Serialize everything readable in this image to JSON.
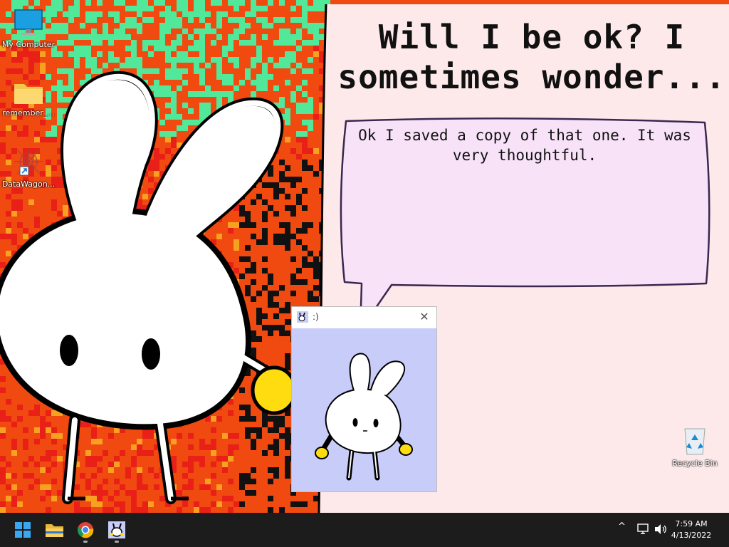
{
  "desktop_icons": [
    {
      "label": "My Computer",
      "icon": "monitor-icon"
    },
    {
      "label": "remember_...",
      "icon": "folder-icon"
    },
    {
      "label": "DataWagon...",
      "icon": "datawagon-shortcut-icon"
    },
    {
      "label": "Recycle Bin",
      "icon": "recycle-bin-icon"
    }
  ],
  "speech": {
    "title_line1": "Will I be ok? I",
    "title_line2": "sometimes wonder...",
    "message_line1": "Ok I saved a copy of that one. It was",
    "message_line2": "very thoughtful."
  },
  "window": {
    "title": ":)",
    "close_glyph": "✕",
    "content_bg": "#c8ccf8"
  },
  "taskbar": {
    "apps": [
      {
        "name": "start",
        "icon": "windows-start-icon"
      },
      {
        "name": "file-explorer",
        "icon": "folder-icon"
      },
      {
        "name": "chrome",
        "icon": "chrome-icon"
      },
      {
        "name": "bunny-app",
        "icon": "bunny-icon"
      }
    ],
    "tray": {
      "chevron": "^",
      "time": "7:59 AM",
      "date": "4/13/2022"
    }
  },
  "colors": {
    "background_orange": "#f04a10",
    "pixel_green": "#52e89a",
    "pixel_red": "#e82018",
    "speech_fill": "#fde9ea",
    "bubble_fill": "#f8e2f8",
    "bunny_yellow": "#ffdc10",
    "taskbar": "#1c1c1c"
  }
}
